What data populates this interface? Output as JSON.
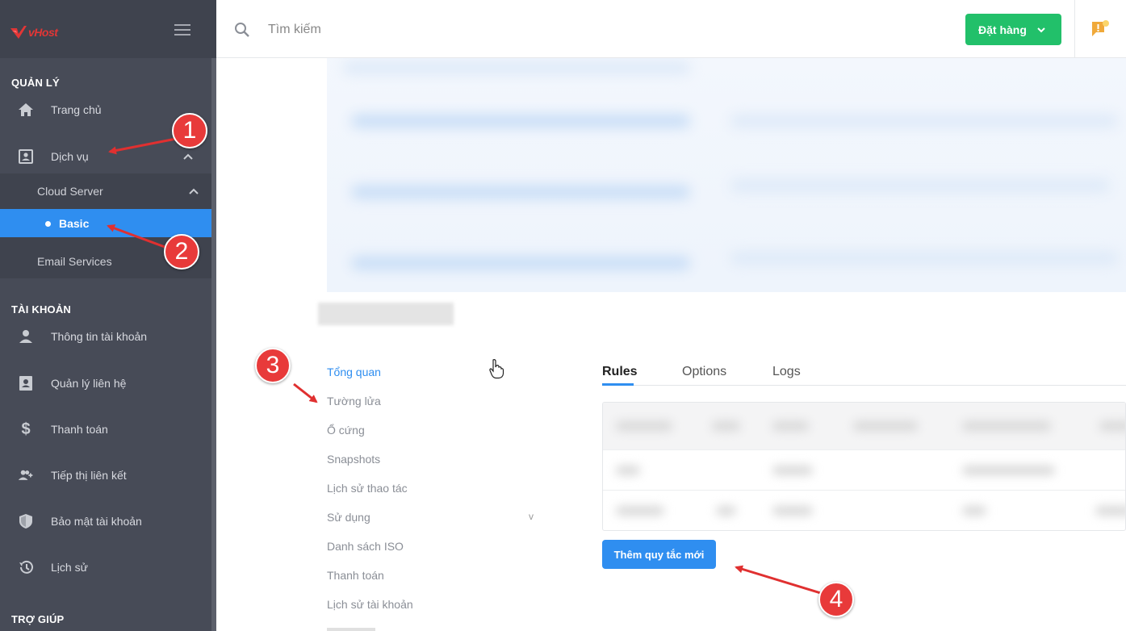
{
  "brand": {
    "logo_text": "vHost"
  },
  "sidebar": {
    "sections": {
      "manage": "QUẢN LÝ",
      "account": "TÀI KHOẢN",
      "help": "TRỢ GIÚP"
    },
    "manage_items": {
      "home": "Trang chủ",
      "services": "Dịch vụ",
      "cloud_server": "Cloud Server",
      "basic": "Basic",
      "email_services": "Email Services"
    },
    "account_items": {
      "account_info": "Thông tin tài khoản",
      "contacts": "Quản lý liên hệ",
      "payment": "Thanh toán",
      "affiliate": "Tiếp thị liên kết",
      "security": "Bảo mật tài khoản",
      "history": "Lịch sử"
    }
  },
  "header": {
    "search_placeholder": "Tìm kiếm",
    "order_button": "Đặt hàng"
  },
  "server_menu": {
    "overview": "Tổng quan",
    "firewall": "Tường lửa",
    "disk": "Ổ cứng",
    "snapshots": "Snapshots",
    "action_history": "Lịch sử thao tác",
    "usage": "Sử dụng",
    "iso_list": "Danh sách ISO",
    "billing": "Thanh toán",
    "account_history": "Lịch sử tài khoản",
    "caret": "v"
  },
  "tabs": {
    "rules": "Rules",
    "options": "Options",
    "logs": "Logs"
  },
  "add_rule_button": "Thêm quy tắc mới",
  "annotations": {
    "a1": "1",
    "a2": "2",
    "a3": "3",
    "a4": "4"
  },
  "colors": {
    "sidebar_bg": "#474b57",
    "accent_blue": "#2f8ef0",
    "order_green": "#22c06a",
    "annotation_red": "#e83a3a"
  }
}
